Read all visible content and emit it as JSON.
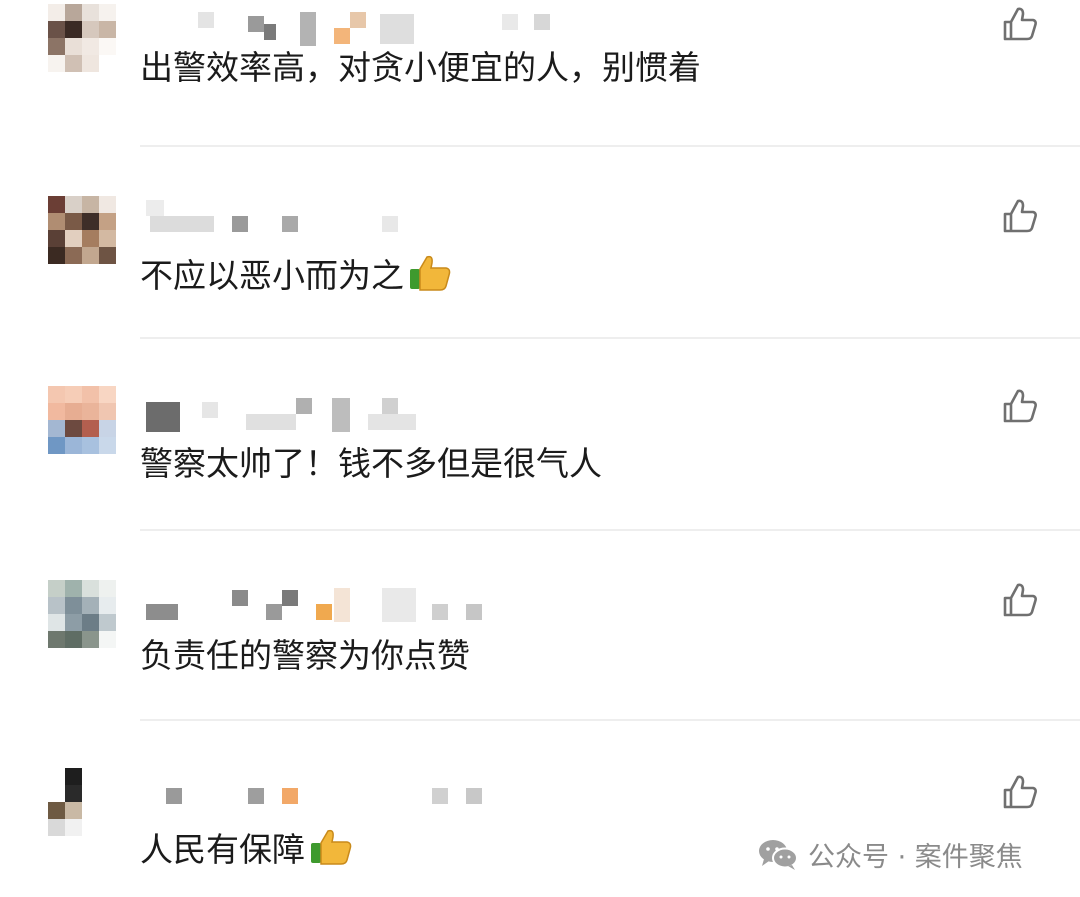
{
  "comments": [
    {
      "text": "出警效率高，对贪小便宜的人，别惯着",
      "emoji": ""
    },
    {
      "text": "不应以恶小而为之",
      "emoji": "thumbs-up-emoji"
    },
    {
      "text": "警察太帅了！钱不多但是很气人",
      "emoji": ""
    },
    {
      "text": "负责任的警察为你点赞",
      "emoji": ""
    },
    {
      "text": "人民有保障",
      "emoji": "thumbs-up-emoji"
    }
  ],
  "icons": {
    "like": "thumbs-up-outline-icon",
    "watermark": "wechat-icon"
  },
  "watermark": {
    "text": "公众号 · 案件聚焦"
  },
  "colors": {
    "text": "#1b1b1b",
    "divider": "#eeeeee",
    "icon": "#707070",
    "watermark": "#8a8a8a"
  }
}
